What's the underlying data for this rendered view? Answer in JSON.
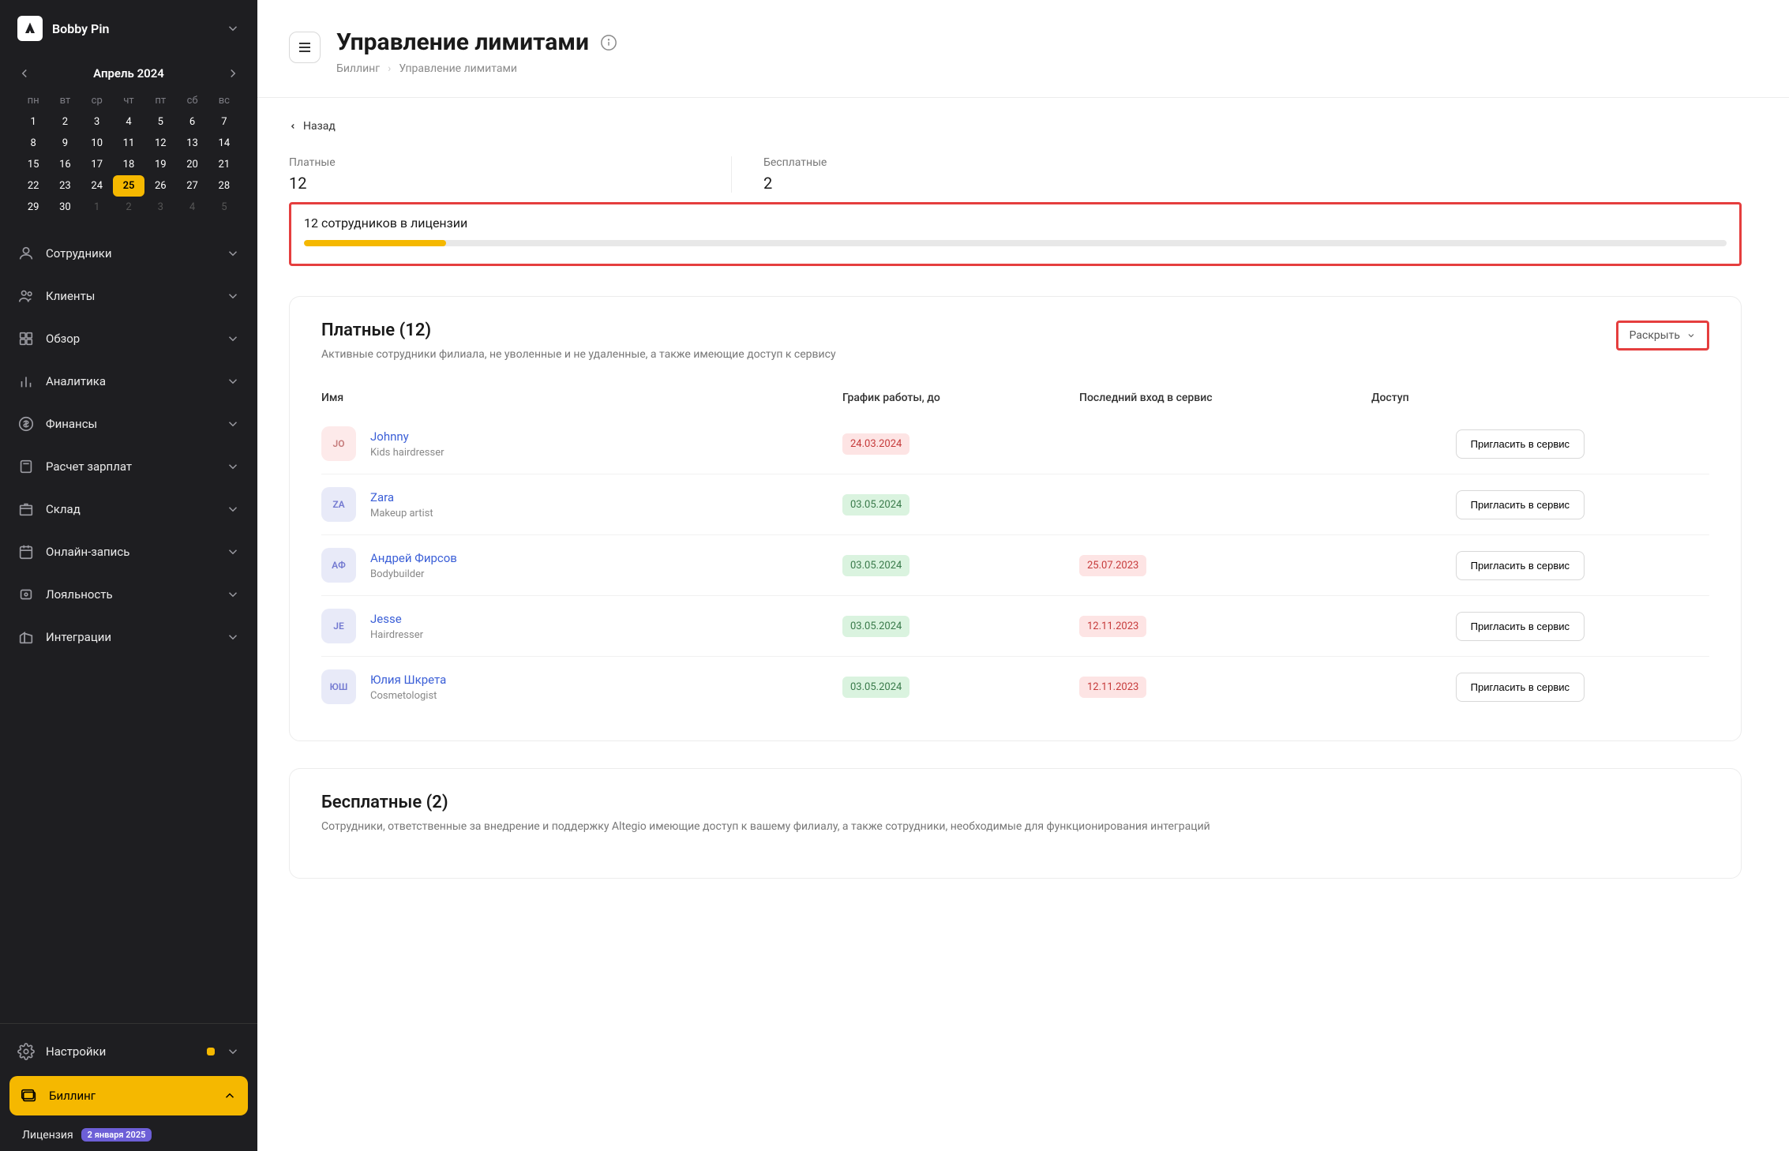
{
  "sidebar": {
    "brand": "Bobby Pin",
    "calendar": {
      "title": "Апрель 2024",
      "dow": [
        "пн",
        "вт",
        "ср",
        "чт",
        "пт",
        "сб",
        "вс"
      ],
      "days": [
        {
          "n": "1",
          "m": false
        },
        {
          "n": "2",
          "m": false
        },
        {
          "n": "3",
          "m": false
        },
        {
          "n": "4",
          "m": false
        },
        {
          "n": "5",
          "m": false
        },
        {
          "n": "6",
          "m": false
        },
        {
          "n": "7",
          "m": false
        },
        {
          "n": "8",
          "m": false
        },
        {
          "n": "9",
          "m": false
        },
        {
          "n": "10",
          "m": false
        },
        {
          "n": "11",
          "m": false
        },
        {
          "n": "12",
          "m": false
        },
        {
          "n": "13",
          "m": false
        },
        {
          "n": "14",
          "m": false
        },
        {
          "n": "15",
          "m": false
        },
        {
          "n": "16",
          "m": false
        },
        {
          "n": "17",
          "m": false
        },
        {
          "n": "18",
          "m": false
        },
        {
          "n": "19",
          "m": false
        },
        {
          "n": "20",
          "m": false
        },
        {
          "n": "21",
          "m": false
        },
        {
          "n": "22",
          "m": false
        },
        {
          "n": "23",
          "m": false
        },
        {
          "n": "24",
          "m": false
        },
        {
          "n": "25",
          "m": false,
          "today": true
        },
        {
          "n": "26",
          "m": false
        },
        {
          "n": "27",
          "m": false
        },
        {
          "n": "28",
          "m": false
        },
        {
          "n": "29",
          "m": false
        },
        {
          "n": "30",
          "m": false
        },
        {
          "n": "1",
          "m": true
        },
        {
          "n": "2",
          "m": true
        },
        {
          "n": "3",
          "m": true
        },
        {
          "n": "4",
          "m": true
        },
        {
          "n": "5",
          "m": true
        }
      ]
    },
    "nav": [
      {
        "label": "Сотрудники",
        "icon": "user"
      },
      {
        "label": "Клиенты",
        "icon": "users"
      },
      {
        "label": "Обзор",
        "icon": "grid"
      },
      {
        "label": "Аналитика",
        "icon": "bars"
      },
      {
        "label": "Финансы",
        "icon": "dollar"
      },
      {
        "label": "Расчет зарплат",
        "icon": "calc"
      },
      {
        "label": "Склад",
        "icon": "box"
      },
      {
        "label": "Онлайн-запись",
        "icon": "calendar"
      },
      {
        "label": "Лояльность",
        "icon": "heart"
      },
      {
        "label": "Интеграции",
        "icon": "building"
      }
    ],
    "settings_label": "Настройки",
    "billing_label": "Биллинг",
    "license_label": "Лицензия",
    "license_pill": "2 января 2025"
  },
  "header": {
    "title": "Управление лимитами",
    "breadcrumb": [
      "Биллинг",
      "Управление лимитами"
    ]
  },
  "back_label": "Назад",
  "stats": {
    "paid_label": "Платные",
    "paid_value": "12",
    "free_label": "Бесплатные",
    "free_value": "2"
  },
  "license_box": {
    "text": "12 сотрудников в лицензии",
    "progress_pct": 10
  },
  "paid_section": {
    "title": "Платные (12)",
    "desc": "Активные сотрудники филиала, не уволенные и не удаленные, а также имеющие доступ к сервису",
    "expand": "Раскрыть",
    "columns": {
      "name": "Имя",
      "schedule": "График работы, до",
      "last_login": "Последний вход в сервис",
      "access": "Доступ"
    },
    "invite_label": "Пригласить в сервис",
    "rows": [
      {
        "initials": "JO",
        "av_bg": "#fdeaea",
        "av_fg": "#c57a7a",
        "name": "Johnny",
        "role": "Kids hairdresser",
        "schedule": "24.03.2024",
        "schedule_color": "red",
        "last": ""
      },
      {
        "initials": "ZA",
        "av_bg": "#e8eaf8",
        "av_fg": "#747ad1",
        "name": "Zara",
        "role": "Makeup artist",
        "schedule": "03.05.2024",
        "schedule_color": "green",
        "last": ""
      },
      {
        "initials": "АФ",
        "av_bg": "#e8eaf8",
        "av_fg": "#747ad1",
        "name": "Андрей Фирсов",
        "role": "Bodybuilder",
        "schedule": "03.05.2024",
        "schedule_color": "green",
        "last": "25.07.2023"
      },
      {
        "initials": "JE",
        "av_bg": "#e8eaf8",
        "av_fg": "#747ad1",
        "name": "Jesse",
        "role": "Hairdresser",
        "schedule": "03.05.2024",
        "schedule_color": "green",
        "last": "12.11.2023"
      },
      {
        "initials": "ЮШ",
        "av_bg": "#e8eaf8",
        "av_fg": "#747ad1",
        "name": "Юлия Шкрета",
        "role": "Cosmetologist",
        "schedule": "03.05.2024",
        "schedule_color": "green",
        "last": "12.11.2023"
      }
    ]
  },
  "free_section": {
    "title": "Бесплатные (2)",
    "desc": "Сотрудники, ответственные за внедрение и поддержку Altegio имеющие доступ к вашему филиалу, а также сотрудники, необходимые для функционирования интеграций"
  }
}
